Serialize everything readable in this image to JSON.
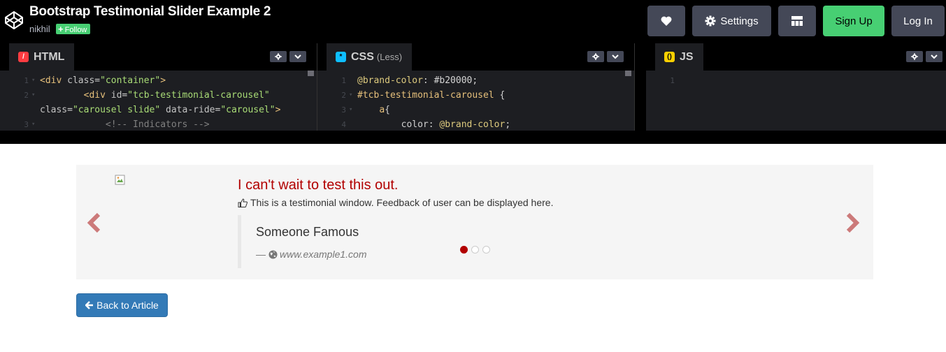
{
  "header": {
    "title": "Bootstrap Testimonial Slider Example 2",
    "author": "nikhil",
    "follow_label": "Follow",
    "buttons": {
      "settings": "Settings",
      "signup": "Sign Up",
      "login": "Log In"
    }
  },
  "editors": {
    "html": {
      "label": "HTML",
      "icon_color": "#ff3c41",
      "lines": [
        {
          "n": "1",
          "fold": "▾",
          "parts": [
            [
              "t-tag",
              "<div "
            ],
            [
              "t-attr",
              "class"
            ],
            [
              "src",
              "="
            ],
            [
              "t-str",
              "\"container\""
            ],
            [
              "t-tag",
              ">"
            ]
          ]
        },
        {
          "n": "2",
          "fold": "▾",
          "parts": [
            [
              "src",
              "        "
            ],
            [
              "t-tag",
              "<div "
            ],
            [
              "t-attr",
              "id"
            ],
            [
              "src",
              "="
            ],
            [
              "t-str",
              "\"tcb-testimonial-carousel\""
            ]
          ]
        },
        {
          "n": "",
          "fold": "",
          "parts": [
            [
              "t-attr",
              "class"
            ],
            [
              "src",
              "="
            ],
            [
              "t-str",
              "\"carousel slide\""
            ],
            [
              "src",
              " "
            ],
            [
              "t-attr",
              "data-ride"
            ],
            [
              "src",
              "="
            ],
            [
              "t-str",
              "\"carousel\""
            ],
            [
              "t-tag",
              ">"
            ]
          ]
        },
        {
          "n": "3",
          "fold": "▾",
          "parts": [
            [
              "src",
              "            "
            ],
            [
              "t-com",
              "<!-- Indicators -->"
            ]
          ]
        }
      ]
    },
    "css": {
      "label": "CSS",
      "sub": "(Less)",
      "icon_color": "#0ebeff",
      "lines": [
        {
          "n": "1",
          "fold": "",
          "parts": [
            [
              "t-var",
              "@brand-color"
            ],
            [
              "src",
              ": "
            ],
            [
              "t-val",
              "#b20000"
            ],
            [
              "src",
              ";"
            ]
          ]
        },
        {
          "n": "2",
          "fold": "▾",
          "parts": [
            [
              "t-sel",
              "#tcb-testimonial-carousel"
            ],
            [
              "src",
              " {"
            ]
          ]
        },
        {
          "n": "3",
          "fold": "▾",
          "parts": [
            [
              "src",
              "    "
            ],
            [
              "t-sel",
              "a"
            ],
            [
              "src",
              "{"
            ]
          ]
        },
        {
          "n": "4",
          "fold": "",
          "parts": [
            [
              "src",
              "        color: "
            ],
            [
              "t-var",
              "@brand-color"
            ],
            [
              "src",
              ";"
            ]
          ]
        }
      ]
    },
    "js": {
      "label": "JS",
      "icon_color": "#fcd000",
      "lines": [
        {
          "n": "1",
          "fold": "",
          "parts": []
        }
      ]
    }
  },
  "preview": {
    "testimonial": {
      "title": "I can't wait to test this out.",
      "subtitle": "This is a testimonial window. Feedback of user can be displayed here.",
      "name": "Someone Famous",
      "dash": "—",
      "site": "www.example1.com"
    },
    "carousel": {
      "slide_count": 3,
      "active_index": 0
    },
    "back_button": "Back to Article",
    "colors": {
      "brand": "#b20000",
      "button": "#337ab7"
    }
  }
}
